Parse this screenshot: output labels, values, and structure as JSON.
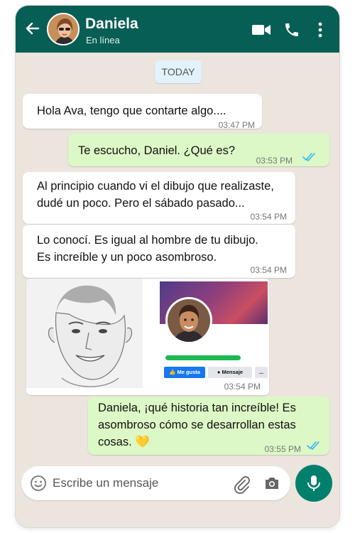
{
  "header": {
    "contact_name": "Daniela",
    "status": "En línea",
    "icons": [
      "back-arrow-icon",
      "video-call-icon",
      "phone-icon",
      "more-options-icon"
    ]
  },
  "date_chip": "TODAY",
  "messages": [
    {
      "direction": "incoming",
      "lines": [
        "Hola Ava, tengo que contarte algo...."
      ],
      "time": "03:47 PM"
    },
    {
      "direction": "outgoing",
      "lines": [
        "Te escucho, Daniel. ¿Qué es?"
      ],
      "time": "03:53 PM",
      "status": "read"
    },
    {
      "direction": "incoming",
      "lines": [
        "Al principio cuando vi el dibujo que realizaste,",
        "dudé un poco. Pero el sábado pasado..."
      ],
      "time": "03:54 PM"
    },
    {
      "direction": "incoming",
      "lines": [
        "Lo conocí. Es igual al hombre de tu dibujo.",
        "Es increíble y un poco asombroso."
      ],
      "time": "03:54 PM"
    },
    {
      "direction": "incoming",
      "type": "image",
      "time": "03:54 PM",
      "profile_buttons": {
        "like": "Me gusta",
        "message": "Mensaje",
        "more": "..."
      }
    },
    {
      "direction": "outgoing",
      "lines": [
        "Daniela, ¡qué historia tan increíble! Es",
        "asombroso cómo se desarrollan estas",
        "cosas."
      ],
      "emoji": "💛",
      "time": "03:55 PM",
      "status": "read"
    }
  ],
  "composer": {
    "placeholder": "Escribe un mensaje"
  },
  "colors": {
    "header": "#075e54",
    "outgoing": "#dcf8c6",
    "incoming": "#ffffff",
    "background": "#ece5dd",
    "read_check": "#34b7f1",
    "mic": "#00806c"
  }
}
